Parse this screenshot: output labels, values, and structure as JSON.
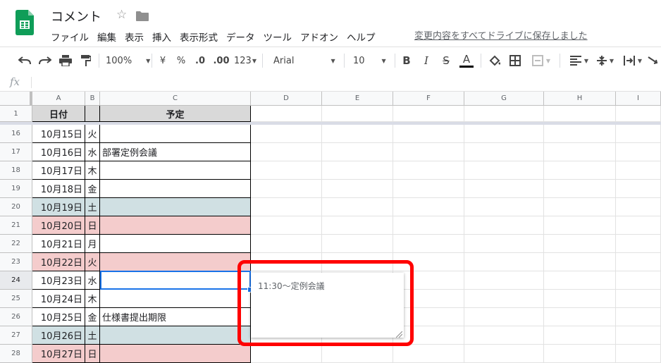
{
  "app": {
    "doc_title": "コメント",
    "save_status": "変更内容をすべてドライブに保存しました",
    "menu": [
      "ファイル",
      "編集",
      "表示",
      "挿入",
      "表示形式",
      "データ",
      "ツール",
      "アドオン",
      "ヘルプ"
    ]
  },
  "toolbar": {
    "zoom": "100%",
    "currency": "¥",
    "percent": "%",
    "decimal_decrease": ".0",
    "decimal_increase": ".00",
    "more_formats": "123",
    "font": "Arial",
    "font_size": "10",
    "bold": "B",
    "italic": "I",
    "strikethrough": "S",
    "text_color": "A"
  },
  "formula_bar": {
    "fx": "fx",
    "value": ""
  },
  "grid": {
    "columns": [
      "A",
      "B",
      "C",
      "D",
      "E",
      "F",
      "G",
      "H",
      "I"
    ],
    "header_row": {
      "num": "1",
      "a": "日付",
      "b": "",
      "c": "予定"
    },
    "rows": [
      {
        "num": "16",
        "date": "10月15日",
        "day": "火",
        "plan": "",
        "type": "normal"
      },
      {
        "num": "17",
        "date": "10月16日",
        "day": "水",
        "plan": "部署定例会議",
        "type": "normal"
      },
      {
        "num": "18",
        "date": "10月17日",
        "day": "木",
        "plan": "",
        "type": "normal"
      },
      {
        "num": "19",
        "date": "10月18日",
        "day": "金",
        "plan": "",
        "type": "normal"
      },
      {
        "num": "20",
        "date": "10月19日",
        "day": "土",
        "plan": "",
        "type": "sat"
      },
      {
        "num": "21",
        "date": "10月20日",
        "day": "日",
        "plan": "",
        "type": "sun"
      },
      {
        "num": "22",
        "date": "10月21日",
        "day": "月",
        "plan": "",
        "type": "normal"
      },
      {
        "num": "23",
        "date": "10月22日",
        "day": "火",
        "plan": "",
        "type": "sun"
      },
      {
        "num": "24",
        "date": "10月23日",
        "day": "水",
        "plan": "",
        "type": "normal"
      },
      {
        "num": "25",
        "date": "10月24日",
        "day": "木",
        "plan": "",
        "type": "normal"
      },
      {
        "num": "26",
        "date": "10月25日",
        "day": "金",
        "plan": "仕様書提出期限",
        "type": "normal"
      },
      {
        "num": "27",
        "date": "10月26日",
        "day": "土",
        "plan": "",
        "type": "sat"
      },
      {
        "num": "28",
        "date": "10月27日",
        "day": "日",
        "plan": "",
        "type": "sun"
      }
    ],
    "selected_row": "24",
    "selected_col": "C"
  },
  "comment": {
    "text": "11:30～定例会議"
  },
  "colors": {
    "saturday": "#d0e0e3",
    "sunday": "#f4cccc",
    "header_fill": "#d9d9d9",
    "selection": "#1a73e8",
    "highlight": "#ff0000",
    "sheets_green": "#0f9d58"
  }
}
